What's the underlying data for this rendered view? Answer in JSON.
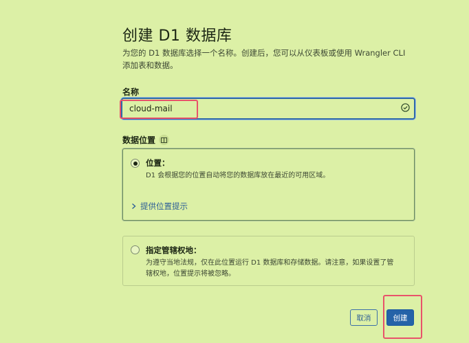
{
  "header": {
    "title": "创建 D1 数据库",
    "description": "为您的 D1 数据库选择一个名称。创建后，您可以从仪表板或使用 Wrangler CLI 添加表和数据。"
  },
  "name_field": {
    "label": "名称",
    "value": "cloud-mail"
  },
  "location": {
    "label": "数据位置",
    "options": [
      {
        "title": "位置：",
        "description": "D1 会根据您的位置自动将您的数据库放在最近的可用区域。",
        "selected": true,
        "hint_link": "提供位置提示"
      },
      {
        "title": "指定管辖权地：",
        "description": "为遵守当地法规，仅在此位置运行 D1 数据库和存储数据。请注意，如果设置了管辖权地，位置提示将被忽略。",
        "selected": false
      }
    ]
  },
  "actions": {
    "cancel_label": "取消",
    "create_label": "创建"
  },
  "colors": {
    "background": "#dcf0a6",
    "primary": "#2563a8",
    "highlight": "#e8526a"
  },
  "icons": {
    "valid": "check-circle-icon",
    "info": "book-icon",
    "expand": "chevron-right-icon"
  }
}
